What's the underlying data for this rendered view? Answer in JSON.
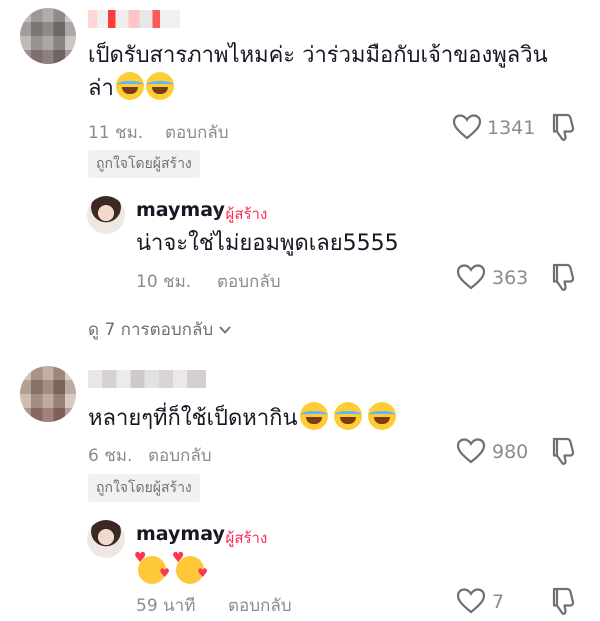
{
  "comments": [
    {
      "text": "เป็ดรับสารภาพไหมค่ะ ว่าร่วมมือกับเจ้าของพูลวิน",
      "text_line2": "ล่า",
      "time": "11 ชม.",
      "reply_label": "ตอบกลับ",
      "like_count": "1341",
      "liked_by_creator": "ถูกใจโดยผู้สร้าง",
      "reply": {
        "username": "maymay",
        "creator_tag": "· ผู้สร้าง",
        "text": "น่าจะใช่ไม่ยอมพูดเลย5555",
        "time": "10 ชม.",
        "reply_label": "ตอบกลับ",
        "like_count": "363"
      },
      "view_replies": "ดู 7 การตอบกลับ"
    },
    {
      "text": "หลายๆที่ก็ใช้เป็ดหากิน",
      "time": "6 ชม.",
      "reply_label": "ตอบกลับ",
      "like_count": "980",
      "liked_by_creator": "ถูกใจโดยผู้สร้าง",
      "reply": {
        "username": "maymay",
        "creator_tag": "· ผู้สร้าง",
        "time": "59 นาที",
        "reply_label": "ตอบกลับ",
        "like_count": "7"
      }
    }
  ],
  "icons": {
    "like": "heart-outline-icon",
    "dislike": "thumbs-down-icon",
    "expand": "chevron-down-icon",
    "laugh_emoji": "face-with-tears-of-joy",
    "love_emoji": "smiling-face-with-hearts"
  },
  "colors": {
    "creator_tag": "#fe2c55",
    "meta_text": "#8a8b91",
    "badge_bg": "#f1f1f2"
  }
}
